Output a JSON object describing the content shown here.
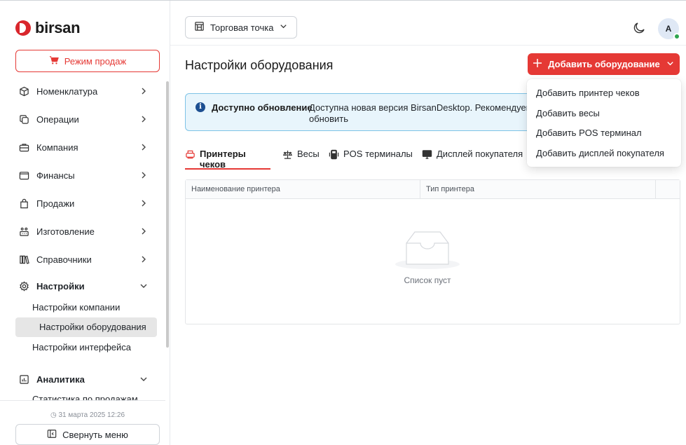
{
  "brand": {
    "name": "birsan"
  },
  "sidebar": {
    "sales_mode_label": "Режим продаж",
    "items": [
      {
        "label": "Номенклатура"
      },
      {
        "label": "Операции"
      },
      {
        "label": "Компания"
      },
      {
        "label": "Финансы"
      },
      {
        "label": "Продажи"
      },
      {
        "label": "Изготовление"
      },
      {
        "label": "Справочники"
      },
      {
        "label": "Настройки",
        "expanded": true
      },
      {
        "label": "Аналитика",
        "expanded": true
      }
    ],
    "settings_subitems": [
      {
        "label": "Настройки компании"
      },
      {
        "label": "Настройки оборудования",
        "active": true
      },
      {
        "label": "Настройки интерфейса"
      }
    ],
    "cut_item": "Статистика по продажам",
    "datetime": "31 марта 2025 12:26",
    "collapse_label": "Свернуть меню"
  },
  "topbar": {
    "store_label": "Торговая точка",
    "avatar_initial": "A"
  },
  "main": {
    "title": "Настройки оборудования",
    "add_button_label": "Добавить оборудование",
    "alert": {
      "title": "Доступно обновление",
      "text": "Доступна новая версия BirsanDesktop. Рекомендуем обновить"
    },
    "tabs": [
      {
        "label": "Принтеры чеков",
        "active": true
      },
      {
        "label": "Весы"
      },
      {
        "label": "POS терминалы"
      },
      {
        "label": "Дисплей покупателя"
      }
    ],
    "table": {
      "columns": [
        "Наименование принтера",
        "Тип принтера",
        ""
      ],
      "rows": [],
      "empty_text": "Список пуст"
    }
  },
  "dropdown": {
    "items": [
      "Добавить принтер чеков",
      "Добавить весы",
      "Добавить POS терминал",
      "Добавить дисплей покупателя"
    ]
  },
  "colors": {
    "accent": "#e53935",
    "info_bg": "#e8f5fc",
    "info_border": "#7ec3e6",
    "active_bg": "#e6e6e6"
  }
}
